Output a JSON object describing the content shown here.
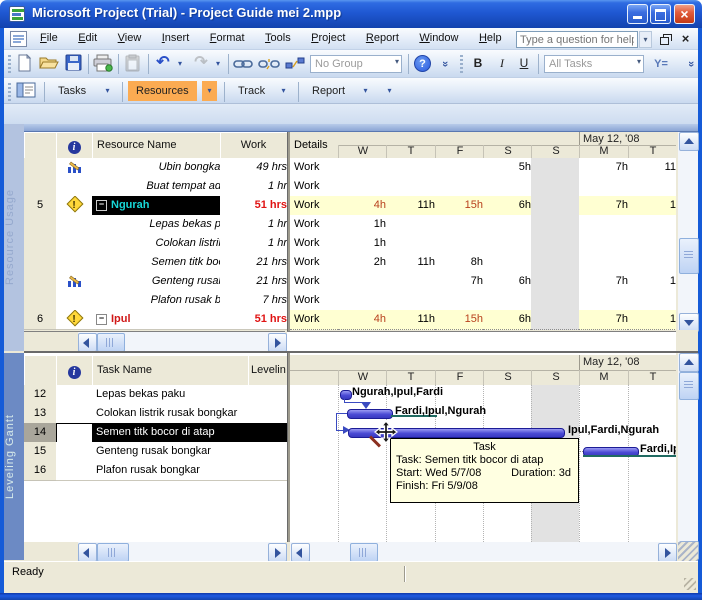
{
  "window": {
    "title": "Microsoft Project (Trial) - Project Guide mei 2.mpp",
    "status": "Ready"
  },
  "glyphs": {
    "caret": "▾",
    "chevron": "»",
    "collapse": "−",
    "overalloc": "!",
    "close": "×",
    "help": "?",
    "info": "i",
    "undo": "↶",
    "redo": "↷",
    "filter": "Y="
  },
  "menu": {
    "items": [
      "File",
      "Edit",
      "View",
      "Insert",
      "Format",
      "Tools",
      "Project",
      "Report",
      "Window",
      "Help"
    ],
    "help_box": {
      "placeholder": "Type a question for help"
    }
  },
  "toolbars": {
    "standard": {
      "group_filter": "No Group"
    },
    "formatting": {
      "bold": "B",
      "italic": "I",
      "underline": "U",
      "task_filter": "All Tasks"
    },
    "guide": {
      "items": [
        "Tasks",
        "Resources",
        "Track",
        "Report"
      ],
      "active": "Resources"
    }
  },
  "colors": {
    "active_button_orange": "#fbab52",
    "gantt_bar_blue": "#4a4ad4",
    "overallocated_red": "#e01414",
    "selected_row_black": "#000000",
    "highlight_yellow": "#ffffd2",
    "nonworking_gray": "#e2e2e2",
    "preleveled_teal": "#206b62"
  },
  "top_pane": {
    "view_label": "Resource Usage",
    "table": {
      "headers": {
        "name": "Resource Name",
        "work": "Work"
      }
    },
    "timeline": {
      "details_header": "Details",
      "week_label": "May 12, '08",
      "days": [
        "W",
        "T",
        "F",
        "S",
        "S",
        "M",
        "T"
      ]
    },
    "rows": [
      {
        "num": "",
        "name": "Ubin bongkar",
        "work": "49 hrs",
        "details": "Work",
        "cells": [
          "",
          "",
          "",
          "5h",
          "",
          "7h",
          "11"
        ]
      },
      {
        "num": "",
        "name": "Buat tempat ad.",
        "work": "1 hr",
        "details": "Work",
        "cells": [
          "",
          "",
          "",
          "",
          "",
          "",
          ""
        ]
      },
      {
        "num": "5",
        "name": "Ngurah",
        "work": "51 hrs",
        "details": "Work",
        "cells": [
          "4h",
          "11h",
          "15h",
          "6h",
          "",
          "7h",
          "1"
        ]
      },
      {
        "num": "",
        "name": "Lepas bekas p.",
        "work": "1 hr",
        "details": "Work",
        "cells": [
          "1h",
          "",
          "",
          "",
          "",
          "",
          ""
        ]
      },
      {
        "num": "",
        "name": "Colokan listrik",
        "work": "1 hr",
        "details": "Work",
        "cells": [
          "1h",
          "",
          "",
          "",
          "",
          "",
          ""
        ]
      },
      {
        "num": "",
        "name": "Semen titk boc",
        "work": "21 hrs",
        "details": "Work",
        "cells": [
          "2h",
          "11h",
          "8h",
          "",
          "",
          "",
          ""
        ]
      },
      {
        "num": "",
        "name": "Genteng rusak",
        "work": "21 hrs",
        "details": "Work",
        "cells": [
          "",
          "",
          "7h",
          "6h",
          "",
          "7h",
          "1"
        ]
      },
      {
        "num": "",
        "name": "Plafon rusak b.",
        "work": "7 hrs",
        "details": "Work",
        "cells": [
          "",
          "",
          "",
          "",
          "",
          "",
          ""
        ]
      },
      {
        "num": "6",
        "name": "Ipul",
        "work": "51 hrs",
        "details": "Work",
        "cells": [
          "4h",
          "11h",
          "15h",
          "6h",
          "",
          "7h",
          "1"
        ]
      }
    ]
  },
  "bottom_pane": {
    "view_label": "Leveling Gantt",
    "table": {
      "headers": {
        "name": "Task Name",
        "leveling": "Levelin"
      }
    },
    "timeline": {
      "week_label": "May 12, '08",
      "days": [
        "W",
        "T",
        "F",
        "S",
        "S",
        "M",
        "T"
      ]
    },
    "rows": [
      {
        "num": "12",
        "name": "Lepas bekas paku"
      },
      {
        "num": "13",
        "name": "Colokan listrik rusak bongkar"
      },
      {
        "num": "14",
        "name": "Semen titk bocor di atap"
      },
      {
        "num": "15",
        "name": "Genteng rusak bongkar"
      },
      {
        "num": "16",
        "name": "Plafon rusak bongkar"
      }
    ],
    "bar_labels": {
      "r12": "Ngurah,Ipul,Fardi",
      "r13": "Fardi,Ipul,Ngurah",
      "r14": "Ipul,Fardi,Ngurah",
      "r15": "Fardi,Ip"
    },
    "tooltip": {
      "title": "Task",
      "task": "Task: Semen titk bocor di atap",
      "start": "Start: Wed 5/7/08",
      "duration": "Duration: 3d",
      "finish": "Finish: Fri 5/9/08"
    }
  }
}
